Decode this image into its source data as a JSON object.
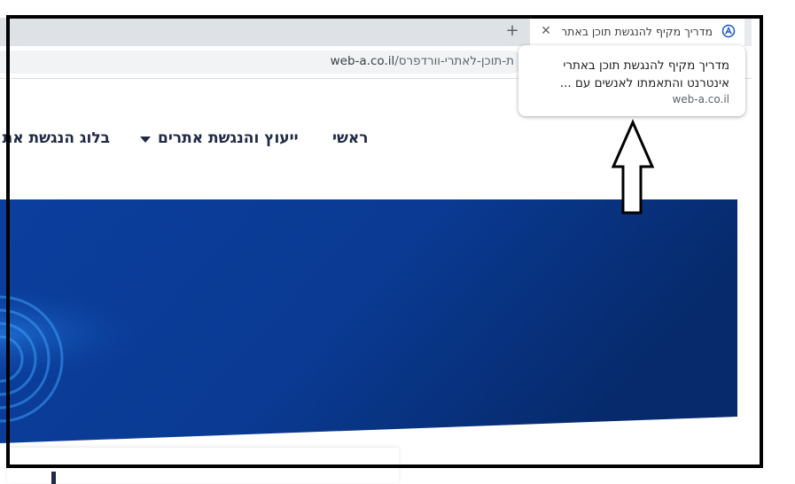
{
  "browser": {
    "tab": {
      "title": "מדריך מקיף להנגשת תוכן באתרי",
      "favicon": "web-a-logo-icon",
      "close_icon": "close-icon"
    },
    "new_tab_icon": "plus-icon",
    "address_bar": {
      "domain": "web-a.co.il",
      "path": "/ת-תוכן-לאתרי-וורדפרס"
    },
    "hover_card": {
      "title": "מדריך מקיף להנגשת תוכן באתרי אינטרנט והתאמתו לאנשים עם ...",
      "domain": "web-a.co.il"
    }
  },
  "site": {
    "nav": {
      "home": "ראשי",
      "consulting": "ייעוץ והנגשת אתרים",
      "blog": "בלוג הנגשת את"
    },
    "hero_color": "#0b3a93",
    "nav_color": "#1f2a44"
  },
  "annotation": {
    "frame_color": "#000000",
    "arrow_icon": "up-arrow-icon"
  }
}
